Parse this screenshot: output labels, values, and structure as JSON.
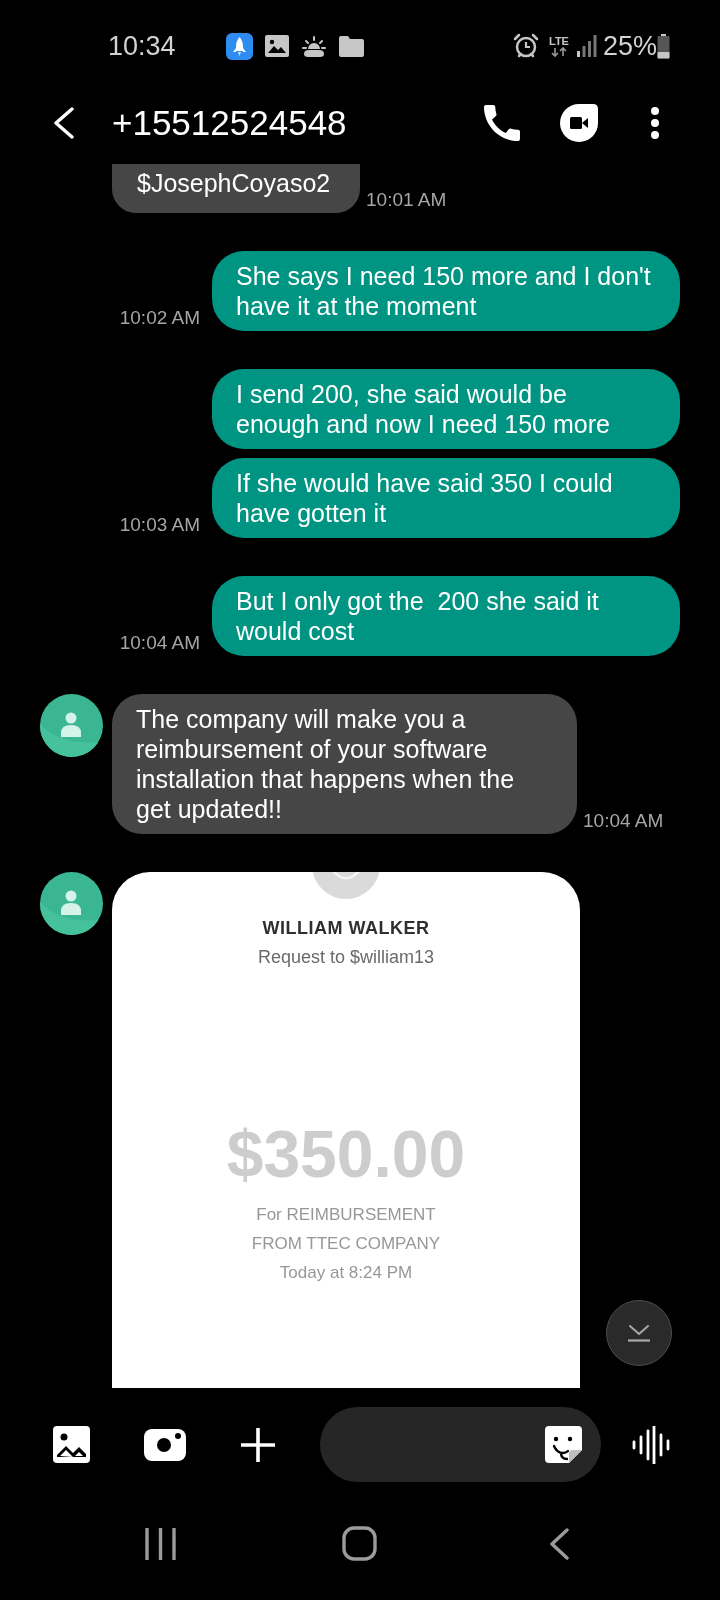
{
  "status_bar": {
    "time": "10:34",
    "network": "LTE",
    "battery": "25%"
  },
  "header": {
    "title": "+15512524548"
  },
  "messages": [
    {
      "kind": "incoming",
      "avatar": false,
      "text": "$JosephCoyaso2",
      "time": "10:01 AM"
    },
    {
      "kind": "outgoing",
      "text": "She says I need 150 more and I don't have it at the moment",
      "time": "10:02 AM"
    },
    {
      "kind": "outgoing",
      "text": "I send 200, she said would be enough and now I need 150 more"
    },
    {
      "kind": "outgoing",
      "text": "If she would have said 350 I could have gotten it",
      "time": "10:03 AM"
    },
    {
      "kind": "outgoing",
      "text": "But I only got the  200 she said it would cost",
      "time": "10:04 AM"
    },
    {
      "kind": "incoming",
      "avatar": true,
      "text": "The company will make you a reimbursement of your software installation that happens when the get updated!!",
      "time": "10:04 AM"
    },
    {
      "kind": "payment_card",
      "avatar": true,
      "name": "WILLIAM WALKER",
      "subtitle": "Request to $william13",
      "amount": "$350.00",
      "note": "For REIMBURSEMENT FROM TTEC COMPANY",
      "date": "Today at 8:24 PM"
    }
  ]
}
